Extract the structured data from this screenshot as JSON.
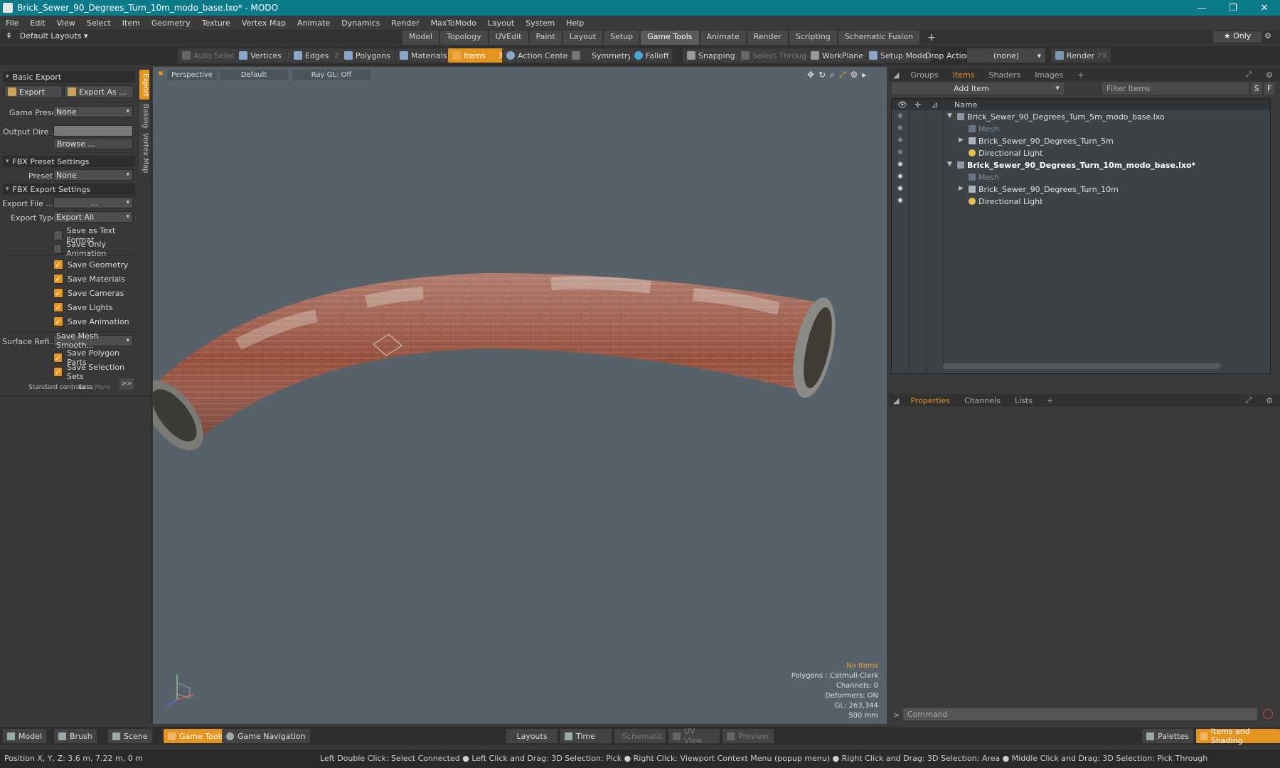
{
  "window": {
    "title": "Brick_Sewer_90_Degrees_Turn_10m_modo_base.lxo* - MODO",
    "minimize": "—",
    "maximize": "❐",
    "close": "✕"
  },
  "menu": [
    "File",
    "Edit",
    "View",
    "Select",
    "Item",
    "Geometry",
    "Texture",
    "Vertex Map",
    "Animate",
    "Dynamics",
    "Render",
    "MaxToModo",
    "Layout",
    "System",
    "Help"
  ],
  "layouts": {
    "default": "Default Layouts",
    "tabs": [
      "Model",
      "Topology",
      "UVEdit",
      "Paint",
      "Layout",
      "Setup",
      "Game Tools",
      "Animate",
      "Render",
      "Scripting",
      "Schematic Fusion"
    ],
    "active_tab": "Game Tools",
    "add": "+",
    "only": "★  Only"
  },
  "toolbar": {
    "auto_select": "Auto Select",
    "vertices": "Vertices",
    "vertices_count": "1",
    "edges": "Edges",
    "edges_count": "2",
    "polygons": "Polygons",
    "materials": "Materials",
    "items": "Items",
    "items_count": "3",
    "action_center": "Action Center",
    "symmetry": "Symmetry",
    "falloff": "Falloff",
    "snapping": "Snapping",
    "select_through": "Select Through",
    "workplane": "WorkPlane",
    "setup_mode": "Setup Mode",
    "drop_action": "Drop Action",
    "drop_value": "(none)",
    "render": "Render",
    "render_key": "F9"
  },
  "left": {
    "tabs": [
      "Export",
      "Baking",
      "Vertex Map"
    ],
    "basic_export": "Basic Export",
    "export": "Export",
    "export_as": "Export As ...",
    "game_preset_label": "Game Preset",
    "game_preset_value": "None",
    "output_dir_label": "Output Dire ...",
    "browse": "Browse ...",
    "fbx_preset_settings": "FBX Preset Settings",
    "preset_label": "Preset",
    "preset_value": "None",
    "fbx_export_settings": "FBX Export Settings",
    "export_file_label": "Export File ...",
    "export_file_value": "...",
    "export_type_label": "Export Type",
    "export_type_value": "Export All",
    "checks": [
      {
        "label": "Save as Text Format",
        "checked": false
      },
      {
        "label": "Save Only Animation",
        "checked": false
      },
      {
        "label": "Save Geometry",
        "checked": true
      },
      {
        "label": "Save Materials",
        "checked": true
      },
      {
        "label": "Save Cameras",
        "checked": true
      },
      {
        "label": "Save Lights",
        "checked": true
      },
      {
        "label": "Save Animation",
        "checked": true
      }
    ],
    "surface_label": "Surface Refi...",
    "surface_value": "Save Mesh Smooth...",
    "checks2": [
      {
        "label": "Save Polygon Parts",
        "checked": true
      },
      {
        "label": "Save Selection Sets",
        "checked": true
      }
    ],
    "standard_controls": "Standard controls",
    "less": "Less",
    "more": "More",
    "expand": ">>"
  },
  "viewport": {
    "perspective": "Perspective",
    "default": "Default",
    "raygl": "Ray GL: Off",
    "info": {
      "no_items": "No Items",
      "polygons": "Polygons : Catmull-Clark",
      "channels": "Channels: 0",
      "deformers": "Deformers: ON",
      "gl": "GL: 263,344",
      "scale": "500 mm"
    }
  },
  "right": {
    "tabs": [
      "Groups",
      "Items",
      "Shaders",
      "Images"
    ],
    "active_tab": "Items",
    "add_item": "Add Item",
    "filter_placeholder": "Filter Items",
    "s": "S",
    "f": "F",
    "col_name": "Name",
    "rows": [
      {
        "label": "Brick_Sewer_90_Degrees_Turn_5m_modo_base.lxo",
        "indent": 0,
        "style": "normal",
        "eye": false,
        "arrow": "▼"
      },
      {
        "label": "Mesh",
        "indent": 1,
        "style": "dim",
        "eye": false,
        "arrow": ""
      },
      {
        "label": "Brick_Sewer_90_Degrees_Turn_5m",
        "indent": 1,
        "style": "normal",
        "eye": false,
        "arrow": "▶"
      },
      {
        "label": "Directional Light",
        "indent": 1,
        "style": "normal",
        "eye": false,
        "arrow": ""
      },
      {
        "label": "Brick_Sewer_90_Degrees_Turn_10m_modo_base.lxo*",
        "indent": 0,
        "style": "bold",
        "eye": true,
        "arrow": "▼"
      },
      {
        "label": "Mesh",
        "indent": 1,
        "style": "dim",
        "eye": true,
        "arrow": ""
      },
      {
        "label": "Brick_Sewer_90_Degrees_Turn_10m",
        "indent": 1,
        "style": "normal",
        "eye": true,
        "arrow": "▶"
      },
      {
        "label": "Directional Light",
        "indent": 1,
        "style": "normal",
        "eye": true,
        "arrow": ""
      }
    ],
    "props_tabs": [
      "Properties",
      "Channels",
      "Lists"
    ],
    "props_active": "Properties",
    "command_placeholder": "Command"
  },
  "bottom": {
    "model": "Model",
    "brush": "Brush",
    "scene": "Scene",
    "game_tools": "Game Tools",
    "game_navigation": "Game Navigation",
    "layouts": "Layouts",
    "time": "Time",
    "schematic": "Schematic",
    "uv_view": "UV View",
    "preview": "Preview",
    "palettes": "Palettes",
    "items_shading": "Items and Shading"
  },
  "status": {
    "position": "Position X, Y, Z:   3.6 m, 7.22 m, 0 m",
    "hint": "Left Double Click: Select Connected ● Left Click and Drag: 3D Selection: Pick ● Right Click: Viewport Context Menu (popup menu) ● Right Click and Drag: 3D Selection: Area ● Middle Click and Drag: 3D Selection: Pick Through"
  }
}
